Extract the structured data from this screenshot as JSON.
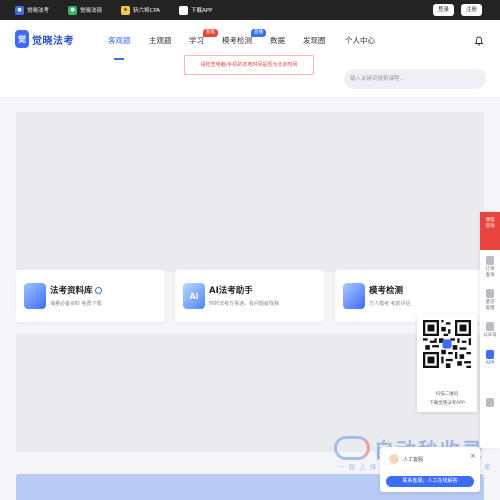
{
  "topbar": {
    "links": [
      {
        "label": "觉晓法考",
        "icon": "juexiao-logo-icon",
        "color": "#3d6cf6"
      },
      {
        "label": "觉晓法硕",
        "icon": "fashuo-logo-icon",
        "color": "#2cb56b"
      },
      {
        "label": "斩六将CPA",
        "icon": "cpa-logo-icon",
        "color": "#f2c94c"
      },
      {
        "label": "下载APP",
        "icon": "apple-icon",
        "color": "#ffffff"
      }
    ],
    "login": "登录",
    "register": "注册"
  },
  "nav": {
    "logo_text": "觉晓法考",
    "items": [
      "客观题",
      "主观题",
      "学习",
      "模考检测",
      "数据",
      "发现圈",
      "个人中心"
    ],
    "active": "客观题",
    "badges": [
      {
        "text": "新版",
        "color": "#e8453c"
      },
      {
        "text": "直播",
        "color": "#3d6cf6"
      }
    ]
  },
  "notice": "请检查电脑/手机的本地时间是否为北京时间",
  "search": {
    "placeholder": "输入关键词搜索课程..."
  },
  "cards": [
    {
      "title": "法考资料库",
      "subtitle": "海量必备资料 免费下载",
      "icon": "book-stack-icon",
      "verified": true
    },
    {
      "title": "AI法考助手",
      "subtitle": "你的法考万事通，有问题就找我",
      "icon": "ai-assistant-icon",
      "verified": false
    },
    {
      "title": "模考检测",
      "subtitle": "万人模考 考前评估",
      "icon": "exam-paper-icon",
      "verified": false
    }
  ],
  "side_rail": {
    "promo": "课程\n咨询",
    "items": [
      "订单\n查询",
      "意见\n反馈",
      "公众号",
      "APP"
    ]
  },
  "qr_popup": {
    "line1": "扫描二维码",
    "line2": "下载觉晓法考APP"
  },
  "chat": {
    "agent": "人工客服",
    "button": "联系客服，人工在线解答"
  },
  "watermark": {
    "big": "自动秒收录",
    "small": "一 鼓 上 排 程 → 未 动 一 次 → 自 动 收 录"
  },
  "colors": {
    "accent": "#3d6cf6",
    "danger": "#e8453c",
    "topbar": "#232323"
  }
}
